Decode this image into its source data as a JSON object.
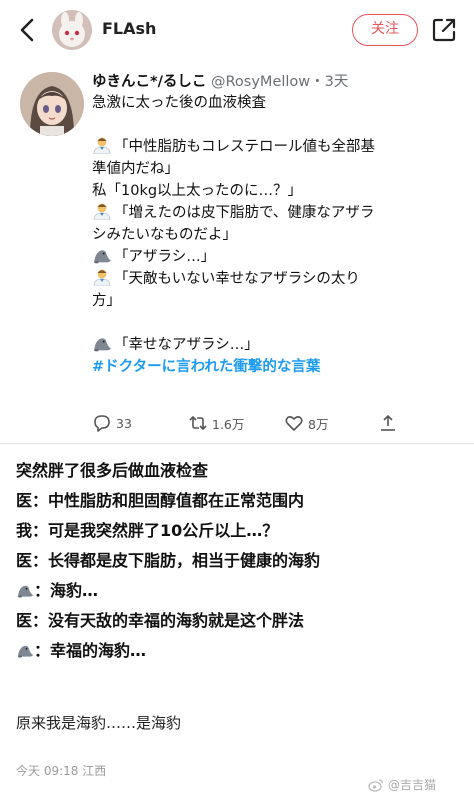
{
  "topbar": {
    "username": "FLAsh",
    "follow_label": "关注"
  },
  "tweet": {
    "display_name": "ゆきんこ*/るしこ",
    "handle_time": "@RosyMellow・3天",
    "lines": [
      {
        "speaker": "",
        "text": "急激に太った後の血液検査"
      },
      {
        "speaker": "",
        "text": ""
      },
      {
        "speaker": "doctor",
        "text": "「中性脂肪もコレステロール値も全部基"
      },
      {
        "speaker": "",
        "text": "準値内だね」"
      },
      {
        "speaker": "",
        "text": "私「10kg以上太ったのに…？」"
      },
      {
        "speaker": "doctor",
        "text": "「増えたのは皮下脂肪で、健康なアザラ"
      },
      {
        "speaker": "",
        "text": "シみたいなものだよ」"
      },
      {
        "speaker": "seal",
        "text": "「アザラシ…」"
      },
      {
        "speaker": "doctor",
        "text": "「天敵もいない幸せなアザラシの太り"
      },
      {
        "speaker": "",
        "text": "方」"
      },
      {
        "speaker": "",
        "text": ""
      },
      {
        "speaker": "seal",
        "text": "「幸せなアザラシ…」"
      }
    ],
    "hashtag": "#ドクターに言われた衝撃的な言葉",
    "stats": {
      "replies": "33",
      "retweets": "1.6万",
      "likes": "8万"
    },
    "icons": {
      "reply": "reply-icon",
      "retweet": "retweet-icon",
      "like": "heart-icon",
      "share": "share-up-icon"
    }
  },
  "translation": {
    "lines": [
      {
        "icon": false,
        "text": "突然胖了很多后做血液检查"
      },
      {
        "icon": false,
        "text": "医：中性脂肪和胆固醇值都在正常范围内"
      },
      {
        "icon": false,
        "text": "我：可是我突然胖了10公斤以上…？"
      },
      {
        "icon": false,
        "text": "医：长得都是皮下脂肪，相当于健康的海豹"
      },
      {
        "icon": true,
        "text": "：海豹…"
      },
      {
        "icon": false,
        "text": "医：没有天敌的幸福的海豹就是这个胖法"
      },
      {
        "icon": true,
        "text": "：幸福的海豹…"
      }
    ],
    "conclusion": "原来我是海豹……是海豹"
  },
  "footer": {
    "meta": "今天 09:18 江西",
    "watermark": "@吉吉猫"
  },
  "colors": {
    "accent_red": "#e8545d",
    "hashtag_blue": "#1d9bf0"
  }
}
